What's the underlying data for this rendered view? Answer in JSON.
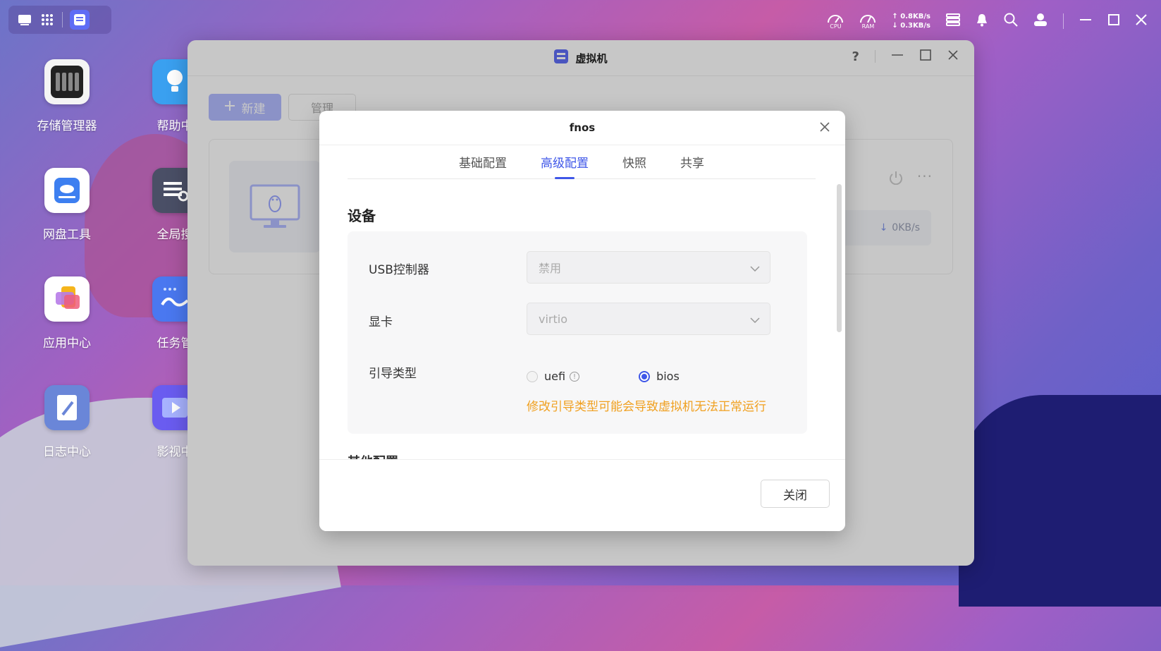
{
  "taskbar": {
    "cpu_label": "CPU",
    "ram_label": "RAM",
    "upload": "0.8KB/s",
    "download": "0.3KB/s"
  },
  "desktop_icons": [
    {
      "label": "存储管理器",
      "icon": "storage-manager-icon"
    },
    {
      "label": "帮助中",
      "icon": "help-center-icon"
    },
    {
      "label": "网盘工具",
      "icon": "cloud-drive-icon"
    },
    {
      "label": "全局搜",
      "icon": "global-search-icon"
    },
    {
      "label": "应用中心",
      "icon": "app-center-icon"
    },
    {
      "label": "任务管",
      "icon": "task-manager-icon"
    },
    {
      "label": "日志中心",
      "icon": "log-center-icon"
    },
    {
      "label": "影视中",
      "icon": "video-center-icon"
    }
  ],
  "window": {
    "title": "虚拟机",
    "help": "?",
    "new_button": "新建",
    "manage_button": "管理",
    "vm_speed": "0KB/s",
    "more": "···"
  },
  "dialog": {
    "title": "fnos",
    "tabs": [
      {
        "label": "基础配置",
        "active": false
      },
      {
        "label": "高级配置",
        "active": true
      },
      {
        "label": "快照",
        "active": false
      },
      {
        "label": "共享",
        "active": false
      }
    ],
    "section_title": "设备",
    "usb_label": "USB控制器",
    "usb_value": "禁用",
    "gpu_label": "显卡",
    "gpu_value": "virtio",
    "boot_label": "引导类型",
    "boot_options": [
      "uefi",
      "bios"
    ],
    "boot_selected": "bios",
    "boot_warning": "修改引导类型可能会导致虚拟机无法正常运行",
    "next_section": "其他配置",
    "close_button": "关闭"
  },
  "colors": {
    "accent": "#3f57e8",
    "warning": "#f0a020"
  }
}
